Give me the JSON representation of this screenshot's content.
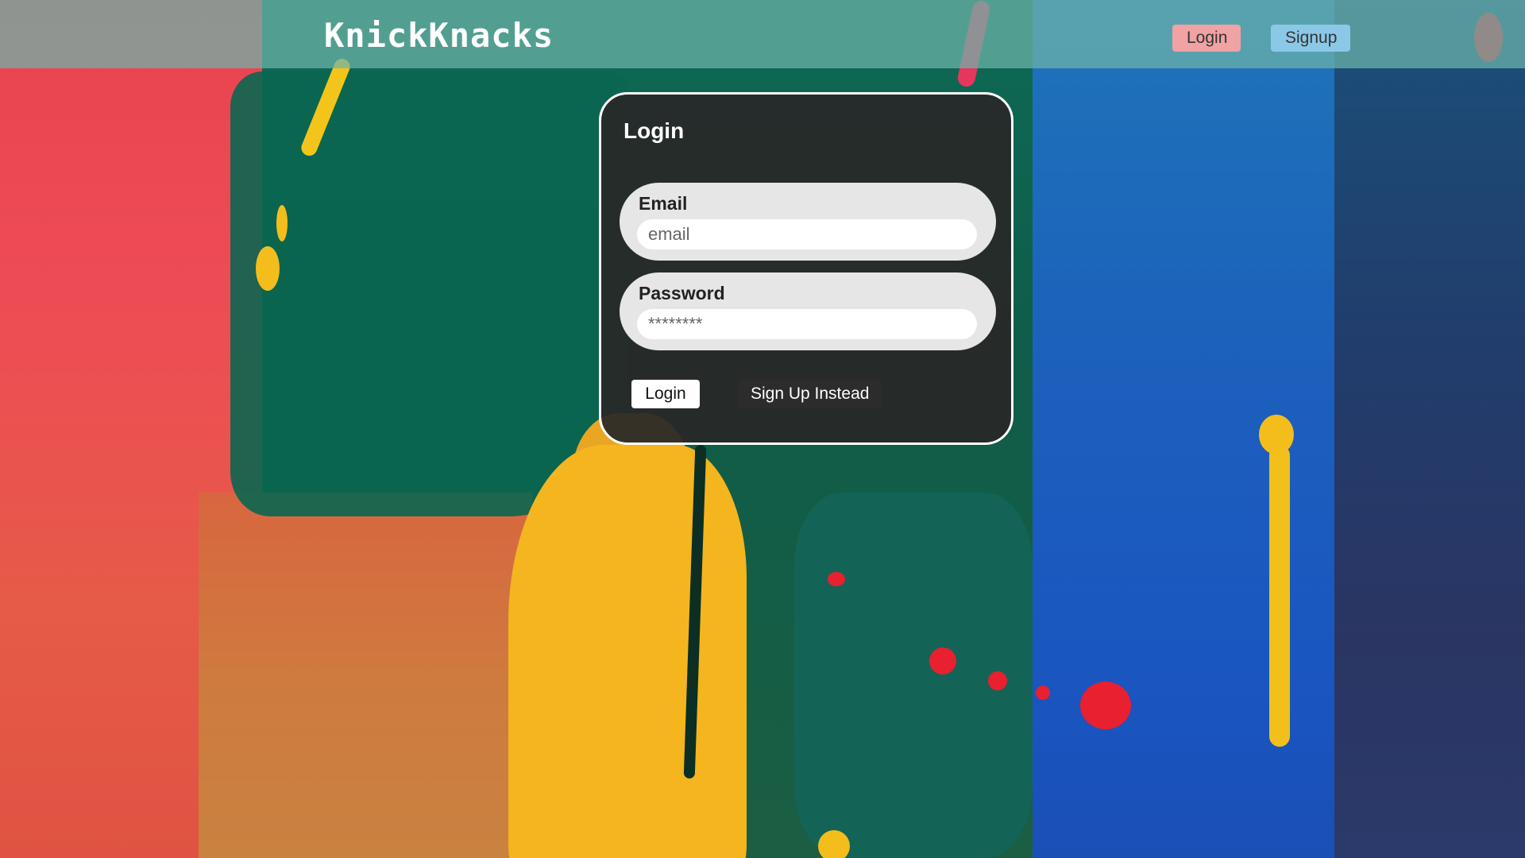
{
  "header": {
    "brand": "KnickKnacks",
    "login_label": "Login",
    "signup_label": "Signup"
  },
  "login_form": {
    "title": "Login",
    "email": {
      "label": "Email",
      "placeholder": "email",
      "value": ""
    },
    "password": {
      "label": "Password",
      "placeholder": "********",
      "value": ""
    },
    "submit_label": "Login",
    "switch_label": "Sign Up Instead"
  },
  "colors": {
    "header_overlay": "#6eb4aa",
    "nav_login_bg": "#f0a2a4",
    "nav_signup_bg": "#8bc8e8",
    "card_bg": "#282828",
    "field_bg": "#e6e6e6"
  }
}
